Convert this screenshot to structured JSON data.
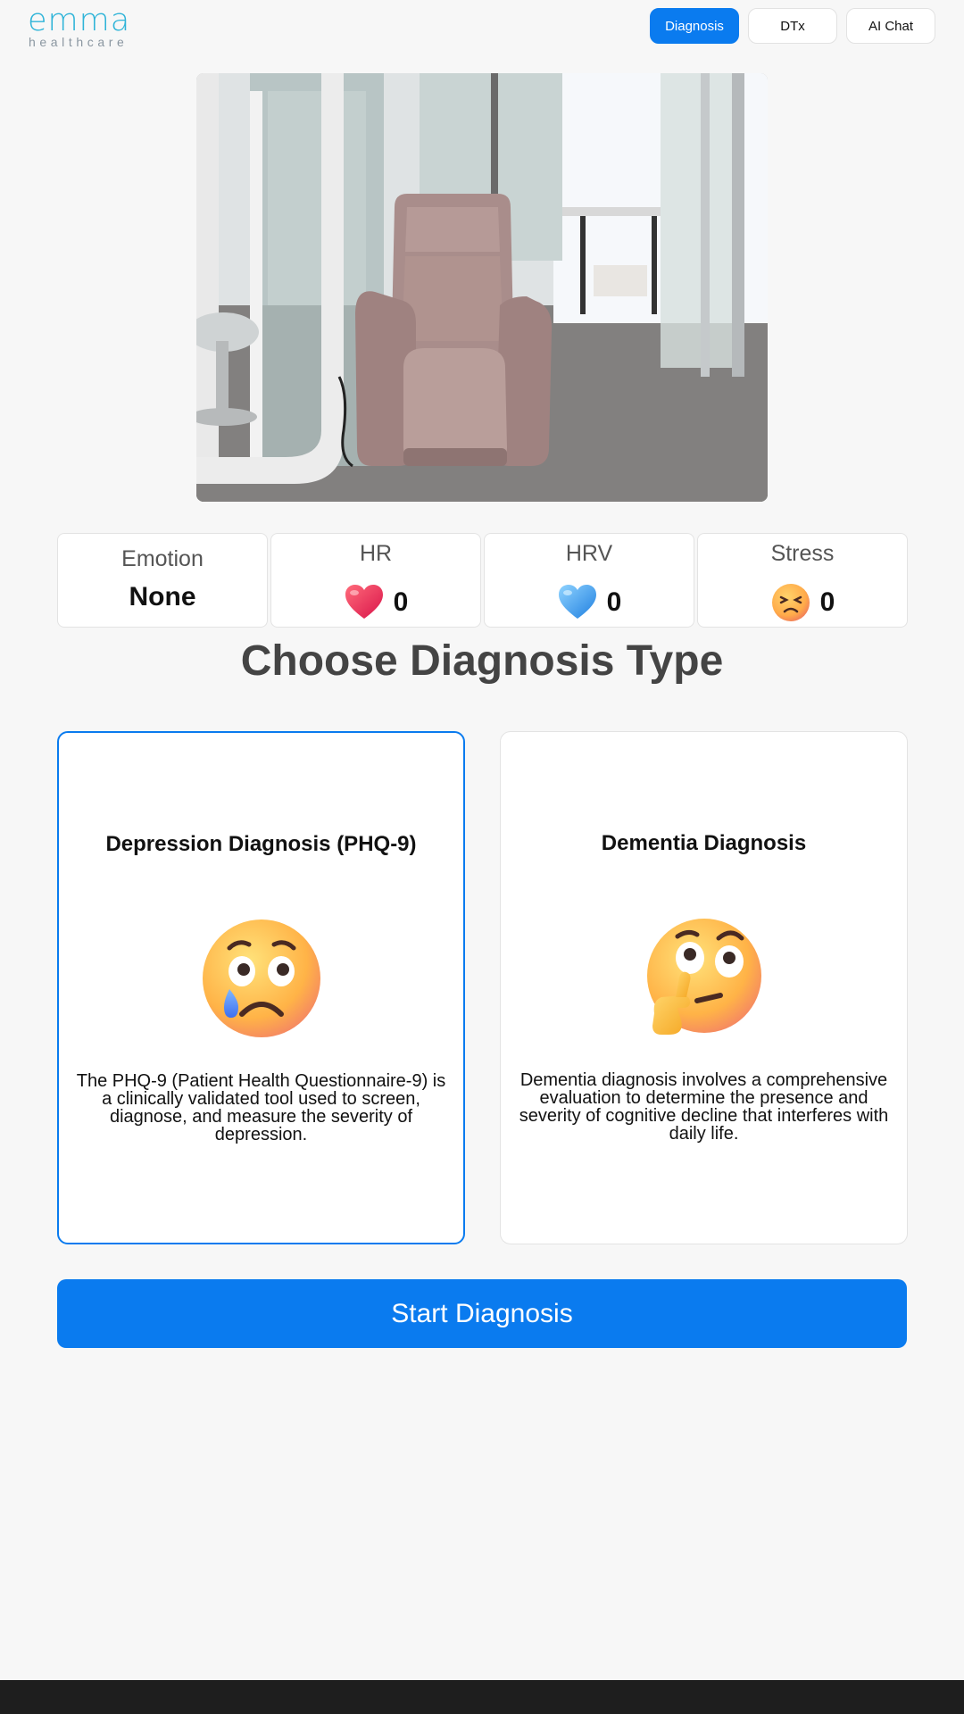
{
  "brand": {
    "name": "emma",
    "tagline": "healthcare"
  },
  "nav": {
    "diagnosis": "Diagnosis",
    "dtx": "DTx",
    "ai_chat": "AI Chat",
    "active": "Diagnosis",
    "active_color": "#0a7bef"
  },
  "metrics": {
    "emotion": {
      "label": "Emotion",
      "value": "None"
    },
    "hr": {
      "label": "HR",
      "value": "0",
      "icon": "red-heart-icon"
    },
    "hrv": {
      "label": "HRV",
      "value": "0",
      "icon": "blue-heart-icon"
    },
    "stress": {
      "label": "Stress",
      "value": "0",
      "icon": "stressed-face-icon"
    }
  },
  "section_title": "Choose Diagnosis Type",
  "cards": [
    {
      "title": "Depression Diagnosis (PHQ-9)",
      "icon": "sad-face-with-tear-icon",
      "description": "The PHQ-9 (Patient Health Questionnaire-9) is a clinically validated tool used to screen, diagnose, and measure the severity of depression.",
      "selected": true
    },
    {
      "title": "Dementia Diagnosis",
      "icon": "thinking-face-icon",
      "description": "Dementia diagnosis involves a comprehensive evaluation to determine the presence and severity of cognitive decline that interferes with daily life.",
      "selected": false
    }
  ],
  "start_button": "Start Diagnosis"
}
